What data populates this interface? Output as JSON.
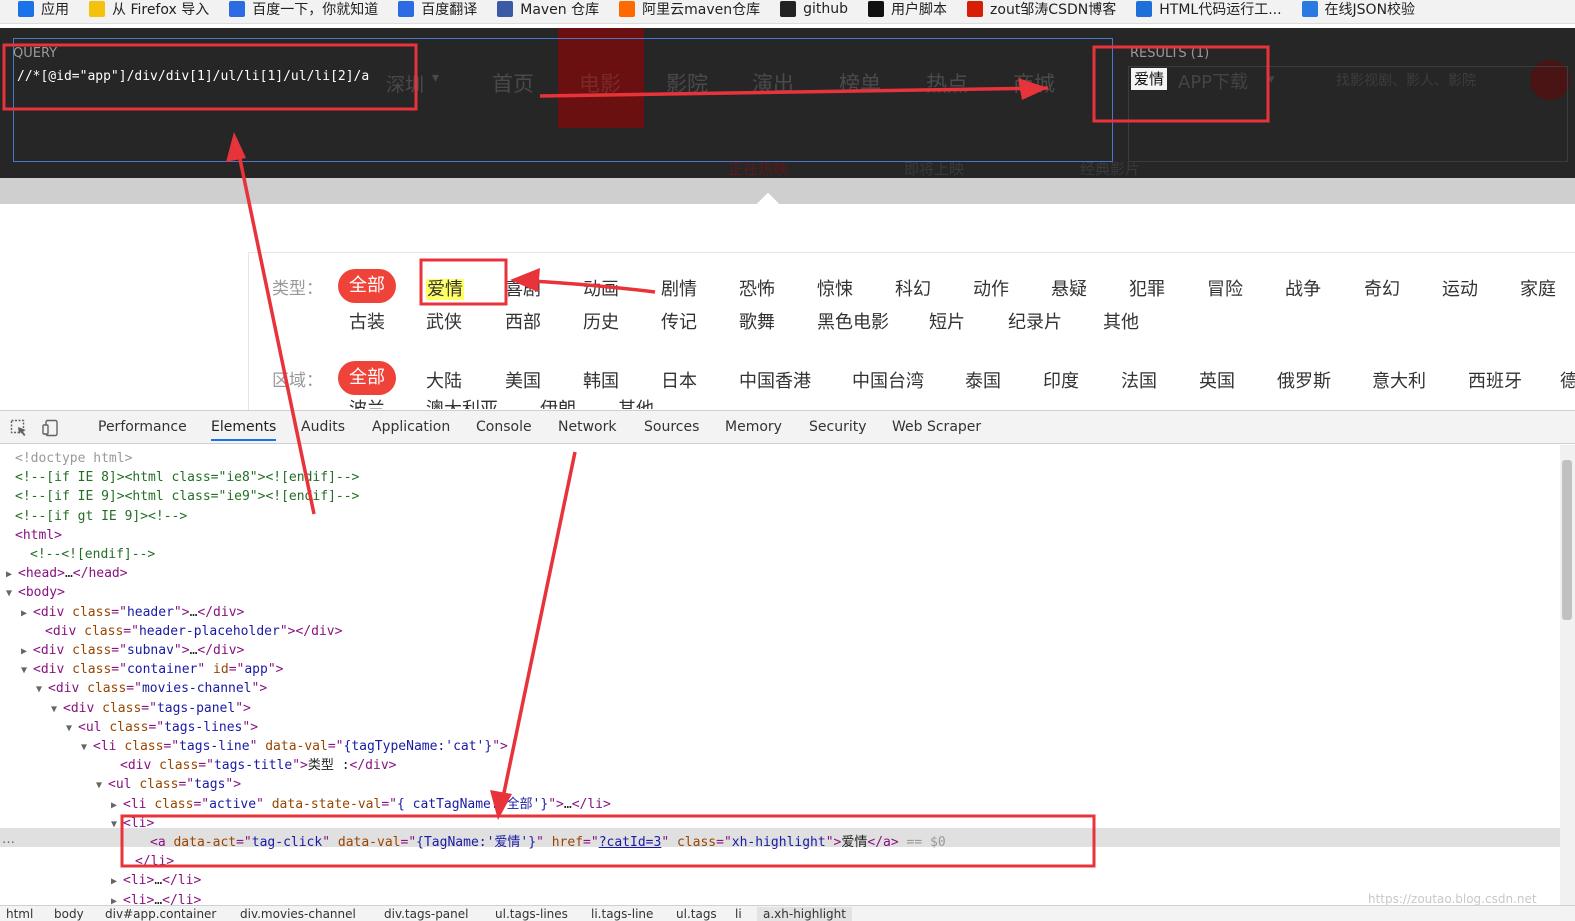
{
  "bookmarks": [
    {
      "label": "应用",
      "icon": "apps-grid-icon",
      "color": "#1a73e8"
    },
    {
      "label": "从 Firefox 导入",
      "icon": "folder-icon",
      "color": "#f4c20d"
    },
    {
      "label": "百度一下，你就知道",
      "icon": "baidu-paw-icon",
      "color": "#2d6be4"
    },
    {
      "label": "百度翻译",
      "icon": "translate-icon",
      "color": "#2d6be4"
    },
    {
      "label": "Maven 仓库",
      "icon": "mvn-icon",
      "color": "#3a5aa8"
    },
    {
      "label": "阿里云maven仓库",
      "icon": "aliyun-icon",
      "color": "#ff6a00"
    },
    {
      "label": "github",
      "icon": "github-icon",
      "color": "#222222"
    },
    {
      "label": "用户脚本",
      "icon": "userscript-icon",
      "color": "#111111"
    },
    {
      "label": "zout邹涛CSDN博客",
      "icon": "csdn-icon",
      "color": "#d81e06"
    },
    {
      "label": "HTML代码运行工...",
      "icon": "html-runner-icon",
      "color": "#1e6fd9"
    },
    {
      "label": "在线JSON校验",
      "icon": "json-icon",
      "color": "#2a7ae2"
    }
  ],
  "site_nav": {
    "city": "深圳",
    "items": [
      "首页",
      "电影",
      "影院",
      "演出",
      "榜单",
      "热点",
      "商城"
    ],
    "subnav": [
      "正在热映",
      "即将上映",
      "经典影片"
    ],
    "app_download": "APP下载",
    "search_placeholder": "找影视剧、影人、影院"
  },
  "xpath_helper": {
    "query_label": "QUERY",
    "query_value": "//*[@id=\"app\"]/div/div[1]/ul/li[1]/ul/li[2]/a",
    "results_label": "RESULTS (1)",
    "result_value": "爱情"
  },
  "filters": {
    "type_title": "类型：",
    "type_tags_row1": [
      "全部",
      "爱情",
      "喜剧",
      "动画",
      "剧情",
      "恐怖",
      "惊悚",
      "科幻",
      "动作",
      "悬疑",
      "犯罪",
      "冒险",
      "战争",
      "奇幻",
      "运动",
      "家庭"
    ],
    "type_tags_row2": [
      "古装",
      "武侠",
      "西部",
      "历史",
      "传记",
      "歌舞",
      "黑色电影",
      "短片",
      "纪录片",
      "其他"
    ],
    "region_title": "区域：",
    "region_tags": [
      "全部",
      "大陆",
      "美国",
      "韩国",
      "日本",
      "中国香港",
      "中国台湾",
      "泰国",
      "印度",
      "法国",
      "英国",
      "俄罗斯",
      "意大利",
      "西班牙",
      "德"
    ],
    "region_tags_row2": [
      "波兰",
      "澳大利亚",
      "伊朗",
      "其他"
    ],
    "active_color": "#ef4238"
  },
  "devtools": {
    "tabs": [
      "Performance",
      "Elements",
      "Audits",
      "Application",
      "Console",
      "Network",
      "Sources",
      "Memory",
      "Security",
      "Web Scraper"
    ],
    "active_tab": "Elements",
    "selected_suffix": "== $0",
    "breadcrumbs": [
      "html",
      "body",
      "div#app.container",
      "div.movies-channel",
      "div.tags-panel",
      "ul.tags-lines",
      "li.tags-line",
      "ul.tags",
      "li",
      "a.xh-highlight"
    ]
  },
  "watermark": "https://zoutao.blog.csdn.net"
}
